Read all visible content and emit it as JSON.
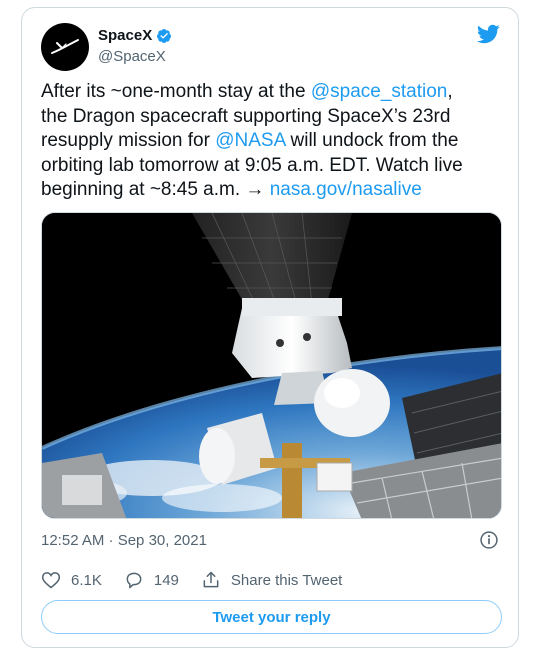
{
  "account": {
    "name": "SpaceX",
    "handle": "@SpaceX",
    "verified": true
  },
  "tweet": {
    "lines": [
      [
        {
          "text": "After its ~one-month stay at the "
        },
        {
          "text": "@space_station",
          "link": true
        },
        {
          "text": ","
        }
      ],
      [
        {
          "text": "the Dragon spacecraft supporting SpaceX’s 23rd"
        }
      ],
      [
        {
          "text": "resupply mission for "
        },
        {
          "text": "@NASA",
          "link": true
        },
        {
          "text": " will undock from the"
        }
      ],
      [
        {
          "text": "orbiting lab tomorrow at 9:05 a.m. EDT. Watch live"
        }
      ],
      [
        {
          "text": "beginning at ~8:45 a.m. → "
        },
        {
          "text": "nasa.gov/nasalive",
          "link": true
        }
      ]
    ],
    "timestamp": "12:52 AM · Sep 30, 2021"
  },
  "media": {
    "description_icon": "spacecraft-photo"
  },
  "actions": {
    "likes": "6.1K",
    "replies": "149",
    "share_label": "Share this Tweet"
  },
  "reply_button": {
    "label": "Tweet your reply"
  },
  "colors": {
    "accent": "#1d9bf0",
    "text": "#0f1419",
    "muted": "#536471",
    "border": "#cfd9de"
  }
}
